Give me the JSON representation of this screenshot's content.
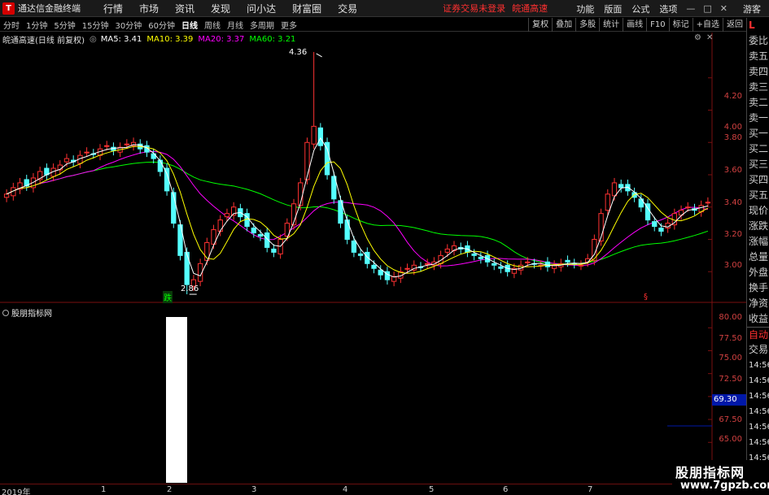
{
  "menubar": {
    "logo": "T",
    "app_title": "通达信金融终端",
    "items": [
      "行情",
      "市场",
      "资讯",
      "发现",
      "问小达",
      "财富圈",
      "交易"
    ],
    "notice": "证券交易未登录",
    "stock_notice": "皖通高速",
    "right_items": [
      "功能",
      "版面",
      "公式",
      "选项"
    ],
    "guest": "游客"
  },
  "toolbar": {
    "periods": [
      "分时",
      "1分钟",
      "5分钟",
      "15分钟",
      "30分钟",
      "60分钟",
      "日线",
      "周线",
      "月线",
      "多周期",
      "更多"
    ],
    "active": "日线",
    "buttons": [
      "复权",
      "叠加",
      "多股",
      "统计",
      "画线",
      "F10",
      "标记",
      "+自选",
      "返回"
    ]
  },
  "legend": {
    "stock": "皖通高速(日线 前复权)",
    "ma5": "MA5: 3.41",
    "ma10": "MA10: 3.39",
    "ma20": "MA20: 3.37",
    "ma60": "MA60: 3.21",
    "colors": {
      "ma5": "#ffffff",
      "ma10": "#ffff00",
      "ma20": "#ff00ff",
      "ma60": "#00ff00"
    }
  },
  "price_axis": [
    "4.20",
    "4.00",
    "3.80",
    "3.60",
    "3.40",
    "3.20",
    "3.00"
  ],
  "annotations": {
    "high": "4.36",
    "low": "2.86",
    "signal": "跌",
    "marker": "§"
  },
  "sub_chart": {
    "title": "股朋指标网",
    "axis": [
      "80.00",
      "77.50",
      "75.00",
      "72.50",
      "70.00",
      "67.50",
      "65.00"
    ],
    "current_value": "69.30"
  },
  "dates": [
    "2019年",
    "1",
    "2",
    "3",
    "4",
    "5",
    "6",
    "7"
  ],
  "right_panel": {
    "top": "L",
    "items": [
      "委比",
      "卖五",
      "卖四",
      "卖三",
      "卖二",
      "卖一",
      "买一",
      "买二",
      "买三",
      "买四",
      "买五",
      "现价",
      "涨跌",
      "涨幅",
      "总量",
      "外盘",
      "换手",
      "净资",
      "收益"
    ],
    "bottom": [
      "自动",
      "交易"
    ],
    "times": [
      "14:56",
      "14:56",
      "14:56",
      "14:56",
      "14:56",
      "14:56",
      "14:56",
      "14:56"
    ]
  },
  "watermark": {
    "line1": "股朋指标网",
    "line2": "www.7gpzb.com"
  },
  "chart_data": {
    "type": "candlestick",
    "title": "皖通高速(日线 前复权)",
    "ylim": [
      2.82,
      4.4
    ],
    "high": 4.36,
    "low": 2.86,
    "series": [
      {
        "name": "MA5",
        "value": 3.41
      },
      {
        "name": "MA10",
        "value": 3.39
      },
      {
        "name": "MA20",
        "value": 3.37
      },
      {
        "name": "MA60",
        "value": 3.21
      }
    ],
    "closes": [
      3.48,
      3.52,
      3.55,
      3.53,
      3.58,
      3.62,
      3.6,
      3.64,
      3.66,
      3.7,
      3.68,
      3.72,
      3.74,
      3.73,
      3.76,
      3.78,
      3.75,
      3.77,
      3.79,
      3.8,
      3.76,
      3.74,
      3.7,
      3.62,
      3.5,
      3.3,
      3.1,
      2.92,
      2.95,
      3.05,
      3.18,
      3.26,
      3.32,
      3.36,
      3.4,
      3.34,
      3.28,
      3.24,
      3.22,
      3.15,
      3.12,
      3.2,
      3.3,
      3.42,
      3.55,
      3.8,
      3.9,
      3.78,
      3.6,
      3.45,
      3.3,
      3.2,
      3.12,
      3.1,
      3.05,
      3.02,
      2.98,
      2.95,
      2.97,
      3.0,
      3.02,
      3.04,
      3.03,
      3.05,
      3.06,
      3.1,
      3.14,
      3.16,
      3.14,
      3.12,
      3.1,
      3.08,
      3.06,
      3.04,
      3.02,
      3.0,
      3.02,
      3.04,
      3.06,
      3.05,
      3.04,
      3.03,
      3.04,
      3.05,
      3.06,
      3.05,
      3.04,
      3.08,
      3.2,
      3.36,
      3.48,
      3.55,
      3.52,
      3.5,
      3.46,
      3.4,
      3.32,
      3.28,
      3.25,
      3.3,
      3.36,
      3.38,
      3.4,
      3.38,
      3.41,
      3.43
    ],
    "sub_indicator": {
      "value": 69.3,
      "ylim": [
        63.0,
        81.0
      ]
    }
  }
}
